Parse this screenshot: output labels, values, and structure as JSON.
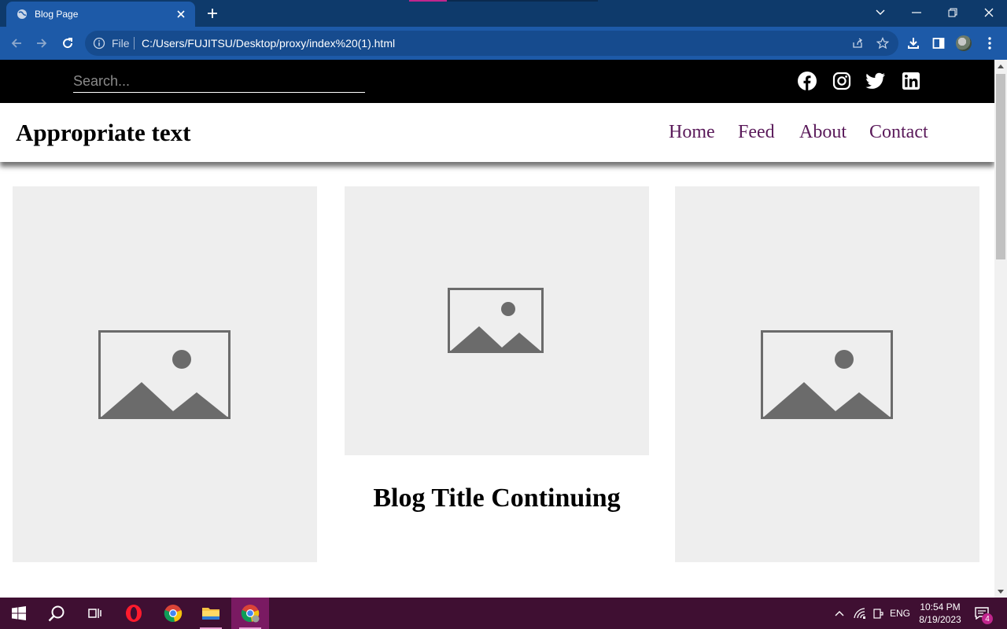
{
  "browser": {
    "tab_title": "Blog Page",
    "scheme_label": "File",
    "url": "C:/Users/FUJITSU/Desktop/proxy/index%20(1).html"
  },
  "site": {
    "search_placeholder": "Search...",
    "social_icons": [
      "facebook-icon",
      "instagram-icon",
      "twitter-icon",
      "linkedin-icon"
    ],
    "brand": "Appropriate text",
    "nav": [
      "Home",
      "Feed",
      "About",
      "Contact"
    ],
    "posts": [
      {
        "image": "image-placeholder"
      },
      {
        "image": "image-placeholder",
        "title": "Blog Title Continuing"
      },
      {
        "image": "image-placeholder"
      }
    ]
  },
  "taskbar": {
    "apps": [
      "start",
      "search",
      "task-view",
      "opera",
      "chrome",
      "file-explorer",
      "chrome-active"
    ],
    "language": "ENG",
    "time": "10:54 PM",
    "date": "8/19/2023",
    "notification_count": "4"
  },
  "colors": {
    "titlebar": "#0e3a6b",
    "toolbar": "#1d5aa8",
    "nav_link": "#5a1a5a",
    "card_bg": "#eeeeee",
    "taskbar": "#3f0f32"
  }
}
